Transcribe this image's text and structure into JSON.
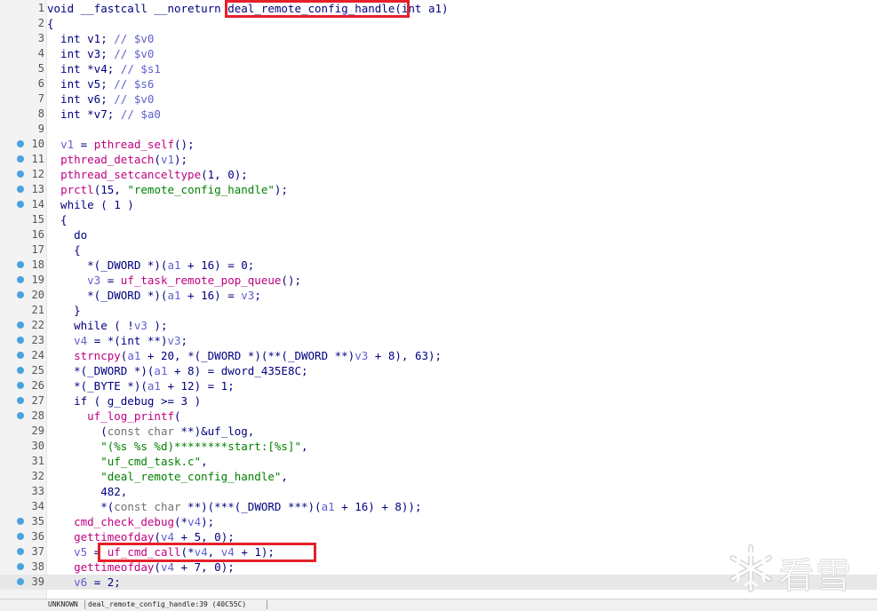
{
  "function_signature": {
    "prefix": "void __fastcall __noreturn ",
    "name": "deal_remote_config_handle",
    "suffix": "(int a1)"
  },
  "lines": [
    {
      "n": "1",
      "bp": false
    },
    {
      "n": "2",
      "bp": false
    },
    {
      "n": "3",
      "bp": false
    },
    {
      "n": "4",
      "bp": false
    },
    {
      "n": "5",
      "bp": false
    },
    {
      "n": "6",
      "bp": false
    },
    {
      "n": "7",
      "bp": false
    },
    {
      "n": "8",
      "bp": false
    },
    {
      "n": "9",
      "bp": false
    },
    {
      "n": "10",
      "bp": true
    },
    {
      "n": "11",
      "bp": true
    },
    {
      "n": "12",
      "bp": true
    },
    {
      "n": "13",
      "bp": true
    },
    {
      "n": "14",
      "bp": true
    },
    {
      "n": "15",
      "bp": false
    },
    {
      "n": "16",
      "bp": false
    },
    {
      "n": "17",
      "bp": false
    },
    {
      "n": "18",
      "bp": true
    },
    {
      "n": "19",
      "bp": true
    },
    {
      "n": "20",
      "bp": true
    },
    {
      "n": "21",
      "bp": false
    },
    {
      "n": "22",
      "bp": true
    },
    {
      "n": "23",
      "bp": true
    },
    {
      "n": "24",
      "bp": true
    },
    {
      "n": "25",
      "bp": true
    },
    {
      "n": "26",
      "bp": true
    },
    {
      "n": "27",
      "bp": true
    },
    {
      "n": "28",
      "bp": true
    },
    {
      "n": "29",
      "bp": false
    },
    {
      "n": "30",
      "bp": false
    },
    {
      "n": "31",
      "bp": false
    },
    {
      "n": "32",
      "bp": false
    },
    {
      "n": "33",
      "bp": false
    },
    {
      "n": "34",
      "bp": false
    },
    {
      "n": "35",
      "bp": true
    },
    {
      "n": "36",
      "bp": true
    },
    {
      "n": "37",
      "bp": true
    },
    {
      "n": "38",
      "bp": true
    },
    {
      "n": "39",
      "bp": true
    }
  ],
  "code": {
    "l2": "{",
    "l3": [
      "  int v1; ",
      "// $v0"
    ],
    "l4": [
      "  int v3; ",
      "// $v0"
    ],
    "l5": [
      "  int *v4; ",
      "// $s1"
    ],
    "l6": [
      "  int v5; ",
      "// $s6"
    ],
    "l7": [
      "  int v6; ",
      "// $v0"
    ],
    "l8": [
      "  int *v7; ",
      "// $a0"
    ],
    "l10": [
      "  ",
      "v1",
      " = ",
      "pthread_self",
      "();"
    ],
    "l11": [
      "  ",
      "pthread_detach",
      "(",
      "v1",
      ");"
    ],
    "l12": [
      "  ",
      "pthread_setcanceltype",
      "(1, 0);"
    ],
    "l13": [
      "  ",
      "prctl",
      "(15, ",
      "\"remote_config_handle\"",
      ");"
    ],
    "l14": "  while ( 1 )",
    "l15": "  {",
    "l16": "    do",
    "l17": "    {",
    "l18": [
      "      *(_DWORD *)(",
      "a1",
      " + 16) = 0;"
    ],
    "l19": [
      "      ",
      "v3",
      " = ",
      "uf_task_remote_pop_queue",
      "();"
    ],
    "l20": [
      "      *(_DWORD *)(",
      "a1",
      " + 16) = ",
      "v3",
      ";"
    ],
    "l21": "    }",
    "l22": [
      "    while ( !",
      "v3",
      " );"
    ],
    "l23": [
      "    ",
      "v4",
      " = *(int **)",
      "v3",
      ";"
    ],
    "l24": [
      "    ",
      "strncpy",
      "(",
      "a1",
      " + 20, *(_DWORD *)(**(_DWORD **)",
      "v3",
      " + 8), 63);"
    ],
    "l25": [
      "    *(_DWORD *)(",
      "a1",
      " + 8) = ",
      "dword_435E8C",
      ";"
    ],
    "l26": [
      "    *(_BYTE *)(",
      "a1",
      " + 12) = 1;"
    ],
    "l27": [
      "    if ( ",
      "g_debug",
      " >= 3 )"
    ],
    "l28": [
      "      ",
      "uf_log_printf",
      "("
    ],
    "l29": [
      "        (",
      "const char",
      " **)&",
      "uf_log",
      ","
    ],
    "l30": [
      "        ",
      "\"(%s %s %d)********start:[%s]\"",
      ","
    ],
    "l31": [
      "        ",
      "\"uf_cmd_task.c\"",
      ","
    ],
    "l32": [
      "        ",
      "\"deal_remote_config_handle\"",
      ","
    ],
    "l33": "        482,",
    "l34": [
      "        *(",
      "const char",
      " **)(***(_DWORD ***)(",
      "a1",
      " + 16) + 8));"
    ],
    "l35": [
      "    ",
      "cmd_check_debug",
      "(*",
      "v4",
      ");"
    ],
    "l36": [
      "    ",
      "gettimeofday",
      "(",
      "v4",
      " + 5, 0);"
    ],
    "l37": [
      "    ",
      "v5",
      " = ",
      "uf_cmd_call",
      "(*",
      "v4",
      ", ",
      "v4",
      " + 1);"
    ],
    "l38": [
      "    ",
      "gettimeofday",
      "(",
      "v4",
      " + 7, 0);"
    ],
    "l39": [
      "    ",
      "v6",
      " = 2;"
    ]
  },
  "status_bar": {
    "segment1": "UNKNOWN",
    "segment2": "deal_remote_config_handle:39 (40C55C)"
  },
  "watermark": {
    "text": "看雪"
  },
  "colors": {
    "highlight_box": "#e5202a",
    "keyword": "#000080",
    "function": "#c00080",
    "variable": "#5f5fd0",
    "string": "#008000",
    "breakpoint": "#4aa3df"
  }
}
